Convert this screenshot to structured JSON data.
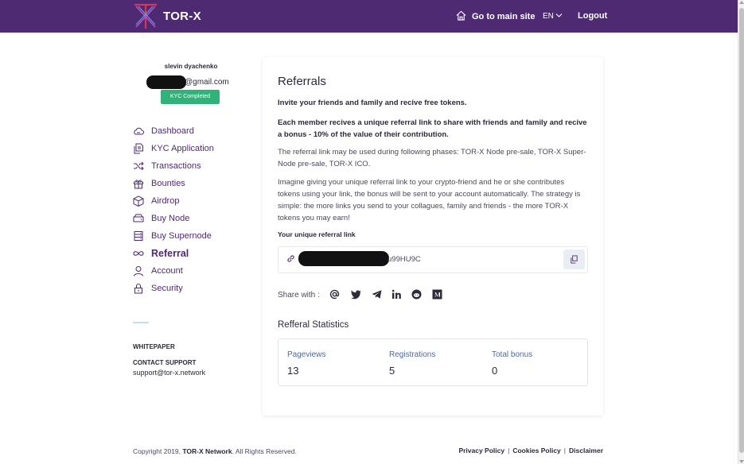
{
  "header": {
    "brand": "TOR-X",
    "main_site": "Go to main site",
    "language": "EN",
    "logout": "Logout"
  },
  "profile": {
    "name": "slevin dyachenko",
    "email_domain": "@gmail.com",
    "kyc_status": "KYC Completed"
  },
  "sidebar": {
    "items": [
      {
        "label": "Dashboard",
        "icon": "cloud-icon"
      },
      {
        "label": "KYC Application",
        "icon": "documents-icon"
      },
      {
        "label": "Transactions",
        "icon": "shuffle-icon"
      },
      {
        "label": "Bounties",
        "icon": "gift-icon"
      },
      {
        "label": "Airdrop",
        "icon": "box-icon"
      },
      {
        "label": "Buy Node",
        "icon": "server-icon"
      },
      {
        "label": "Buy Supernode",
        "icon": "server-stack-icon"
      },
      {
        "label": "Referral",
        "icon": "infinity-icon",
        "active": true
      },
      {
        "label": "Account",
        "icon": "user-icon"
      },
      {
        "label": "Security",
        "icon": "lock-icon"
      }
    ],
    "whitepaper": "WHITEPAPER",
    "contact_support": "CONTACT SUPPORT",
    "support_email": "support@tor-x.network"
  },
  "main": {
    "title": "Referrals",
    "intro": "Invite your friends and family and recive free tokens.",
    "bonus_text": "Each member recives a unique referral link to share with friends and family and recive a bonus - 10% of the value of their contribution.",
    "phases_text": "The referral link may be used during following phases: TOR-X Node pre-sale, TOR-X Super-Node pre-sale, TOR-X ICO.",
    "strategy_text": "Imagine giving your unique referral link to your crypto-friend and he or she contributes tokens using your link, the bonus will be sent to your account automatically. The strategy is simple: the more links you send to your collagues, family and friends - the more TOR-X tokens you may earn!",
    "referral_link_label": "Your unique referral link",
    "referral_link_suffix": "u99HU9C",
    "share_label": "Share with :",
    "share_icons": [
      "email-icon",
      "twitter-icon",
      "telegram-icon",
      "linkedin-icon",
      "reddit-icon",
      "medium-icon"
    ]
  },
  "stats": {
    "title": "Refferal Statistics",
    "pageviews_label": "Pageviews",
    "pageviews": "13",
    "registrations_label": "Registrations",
    "registrations": "5",
    "total_bonus_label": "Total bonus",
    "total_bonus": "0"
  },
  "footer": {
    "copyright_prefix": "Copyright 2019,",
    "copyright_brand": "TOR-X Network",
    "copyright_suffix": ". All Rights Reserved.",
    "privacy": "Privacy Policy",
    "cookies": "Cookies Policy",
    "disclaimer": "Disclaimer"
  },
  "colors": {
    "header_bg": "#4e2a72",
    "kyc_green": "#2fb37a",
    "nav_text": "#4e2a72",
    "stat_label": "#4e6a9a",
    "logo_red": "#e0334f"
  }
}
